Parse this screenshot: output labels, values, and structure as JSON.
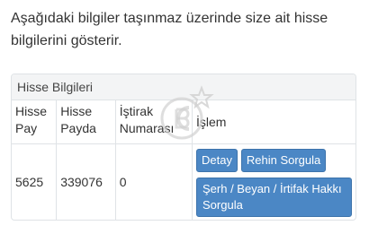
{
  "intro_text": "Aşağıdaki bilgiler taşınmaz üzerinde size ait hisse bilgilerini gösterir.",
  "panel": {
    "title": "Hisse Bilgileri"
  },
  "table": {
    "headers": {
      "pay": "Hisse Pay",
      "payda": "Hisse Payda",
      "istirak": "İştirak Numarası",
      "islem": "İşlem"
    },
    "row": {
      "pay": "5625",
      "payda": "339076",
      "istirak": "0"
    }
  },
  "buttons": {
    "detay": "Detay",
    "rehin": "Rehin Sorgula",
    "serh": "Şerh / Beyan / İrtifak Hakkı Sorgula"
  },
  "colors": {
    "button_bg": "#4b87c5",
    "panel_heading_bg": "#f3f4f5",
    "border": "#dfe3e6"
  }
}
